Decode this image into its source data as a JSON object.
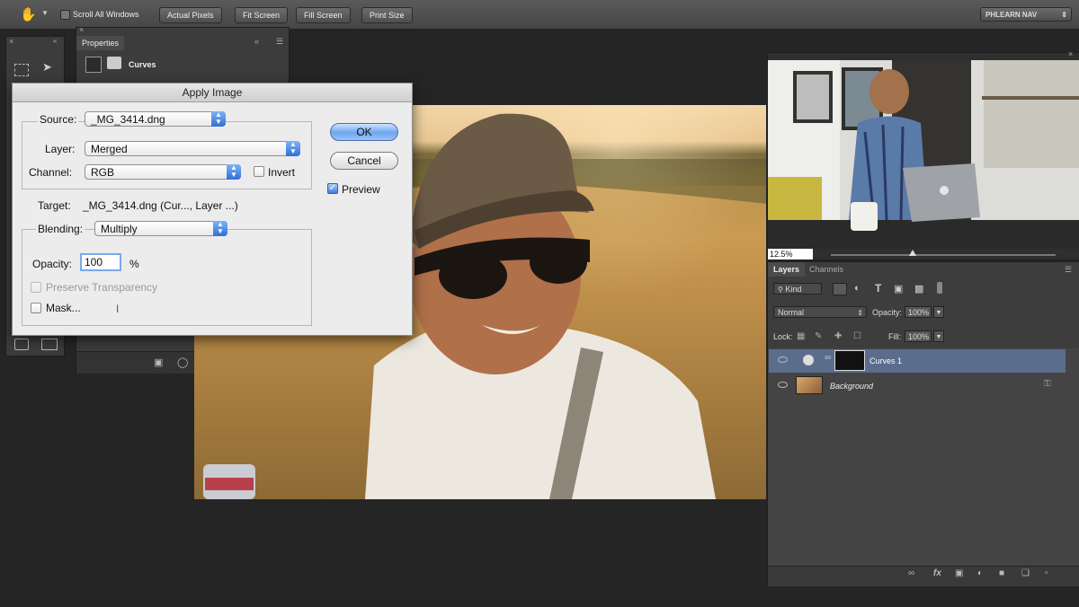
{
  "options_bar": {
    "scroll_all_windows": "Scroll All Windows",
    "actual_pixels": "Actual Pixels",
    "fit_screen": "Fit Screen",
    "fill_screen": "Fill Screen",
    "print_size": "Print Size",
    "workspace": "PHLEARN NAV"
  },
  "properties_panel": {
    "tab": "Properties",
    "title": "Curves"
  },
  "dialog": {
    "title": "Apply Image",
    "source_label": "Source:",
    "source_value": "_MG_3414.dng",
    "layer_label": "Layer:",
    "layer_value": "Merged",
    "channel_label": "Channel:",
    "channel_value": "RGB",
    "invert_label": "Invert",
    "target_label": "Target:",
    "target_value": "_MG_3414.dng (Cur..., Layer ...)",
    "blending_label": "Blending:",
    "blending_value": "Multiply",
    "opacity_label": "Opacity:",
    "opacity_value": "100",
    "opacity_unit": "%",
    "preserve_label": "Preserve Transparency",
    "mask_label": "Mask...",
    "ok_label": "OK",
    "cancel_label": "Cancel",
    "preview_label": "Preview"
  },
  "navigator": {
    "zoom": "12.5%"
  },
  "layers_panel": {
    "tabs": [
      "Layers",
      "Channels"
    ],
    "kind_filter": "Kind",
    "blend_mode": "Normal",
    "opacity_label": "Opacity:",
    "opacity_value": "100%",
    "lock_label": "Lock:",
    "fill_label": "Fill:",
    "fill_value": "100%",
    "layers": [
      {
        "name": "Curves 1",
        "selected": true
      },
      {
        "name": "Background",
        "selected": false
      }
    ]
  },
  "colors": {
    "selected_layer": "#5a6d8c",
    "dialog_default_button": "#6ea5ef"
  }
}
